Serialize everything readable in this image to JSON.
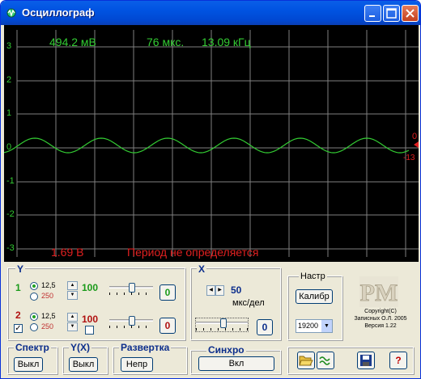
{
  "window": {
    "title": "Осциллограф"
  },
  "readouts": {
    "voltage": "494.2 мВ",
    "time": "76 мкс.",
    "freq": "13.09 кГц",
    "vpp": "1.69 В",
    "period_msg": "Период не определяется"
  },
  "y_axis_labels": [
    "3",
    "2",
    "1",
    "0",
    "-1",
    "-2",
    "-3"
  ],
  "right_marker": {
    "top": "0",
    "bottom": "-13"
  },
  "panel": {
    "y_title": "Y",
    "ch1": {
      "num": "1",
      "opt_a": "12,5",
      "opt_b": "250",
      "value": "100",
      "offset": "0"
    },
    "ch2": {
      "num": "2",
      "opt_a": "12,5",
      "opt_b": "250",
      "value": "100",
      "offset": "0"
    },
    "x_title": "X",
    "x_value": "50",
    "x_unit": "мкс/дел",
    "x_offset": "0",
    "nastr_title": "Настр",
    "calib_label": "Калибр",
    "baud": "19200",
    "logo_text": "PM",
    "copyright_1": "Copyright(C)",
    "copyright_2": "Записных О.Л. 2005",
    "copyright_3": "Версия 1.22",
    "spectr_title": "Спектр",
    "spectr_btn": "Выкл",
    "yx_title": "Y(X)",
    "yx_btn": "Выкл",
    "razv_title": "Развертка",
    "razv_btn": "Непр",
    "sync_title": "Синхро",
    "sync_btn": "Вкл",
    "help_label": "?"
  },
  "colors": {
    "signal": "#33cc33",
    "readout_green": "#33cc33",
    "readout_red": "#e02020",
    "grid": "#808080"
  }
}
